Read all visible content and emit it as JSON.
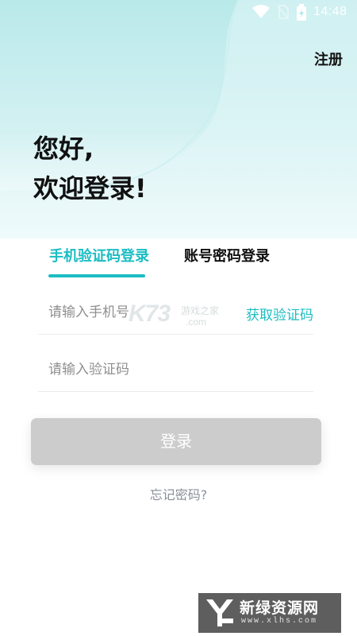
{
  "status_bar": {
    "time": "14:48",
    "icons": [
      "wifi-icon",
      "no-sim-icon",
      "battery-charging-icon"
    ]
  },
  "header": {
    "register_label": "注册"
  },
  "greeting": {
    "line1": "您好,",
    "line2": "欢迎登录!"
  },
  "tabs": [
    {
      "label": "手机验证码登录",
      "active": true
    },
    {
      "label": "账号密码登录",
      "active": false
    }
  ],
  "form": {
    "phone_placeholder": "请输入手机号",
    "phone_value": "",
    "code_placeholder": "请输入验证码",
    "code_value": "",
    "get_code_label": "获取验证码",
    "login_label": "登录",
    "forgot_label": "忘记密码?"
  },
  "watermarks": {
    "k73_logo": "K73",
    "k73_sub": "游戏之家",
    "k73_domain": ".com",
    "site_name": "新绿资源网",
    "site_url": "www.xlhs.com"
  },
  "colors": {
    "accent": "#1bbdc3",
    "header_gradient_top": "#b9e9ea",
    "button_disabled": "#cccccc",
    "text_primary": "#111111",
    "placeholder": "#8f8f8f"
  }
}
